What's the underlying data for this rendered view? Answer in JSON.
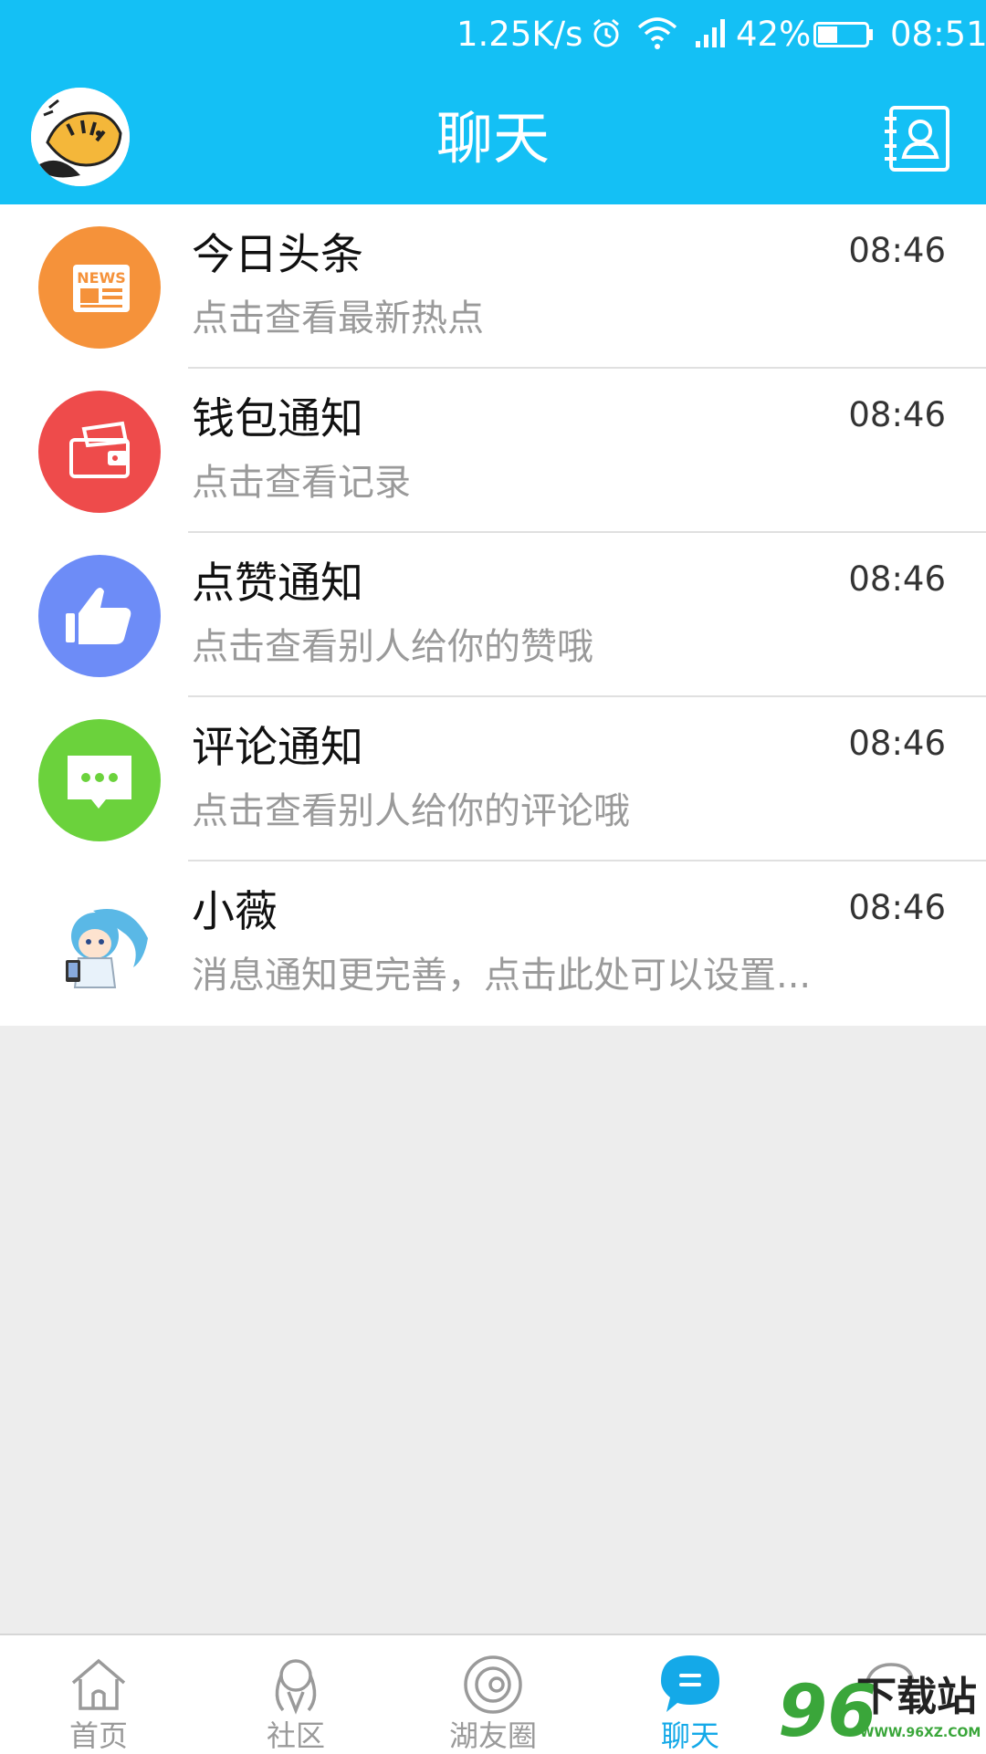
{
  "status_bar": {
    "net_speed": "1.25K/s",
    "battery_percent": "42%",
    "battery_level": 0.42,
    "clock": "08:51"
  },
  "header": {
    "title": "聊天"
  },
  "chats": [
    {
      "title": "今日头条",
      "subtitle": "点击查看最新热点",
      "time": "08:46",
      "icon": "news-icon",
      "color": "#f5923a"
    },
    {
      "title": "钱包通知",
      "subtitle": "点击查看记录",
      "time": "08:46",
      "icon": "wallet-icon",
      "color": "#ee4b4b"
    },
    {
      "title": "点赞通知",
      "subtitle": "点击查看别人给你的赞哦",
      "time": "08:46",
      "icon": "thumbs-up-icon",
      "color": "#6d8cf7"
    },
    {
      "title": "评论通知",
      "subtitle": "点击查看别人给你的评论哦",
      "time": "08:46",
      "icon": "comment-icon",
      "color": "#6bd23c"
    },
    {
      "title": "小薇",
      "subtitle": "消息通知更完善，点击此处可以设置...",
      "time": "08:46",
      "icon": "assistant-avatar-icon",
      "color": "#5ab8e6"
    }
  ],
  "bottom_nav": [
    {
      "label": "首页",
      "icon": "home-icon",
      "active": false
    },
    {
      "label": "社区",
      "icon": "community-icon",
      "active": false
    },
    {
      "label": "湖友圈",
      "icon": "friends-circle-icon",
      "active": false
    },
    {
      "label": "聊天",
      "icon": "chat-icon",
      "active": true
    },
    {
      "label": "",
      "icon": "more-icon",
      "active": false
    }
  ],
  "colors": {
    "brand": "#14c0f5",
    "active_tab": "#14a9e8",
    "background": "#ededed"
  },
  "watermark": {
    "number": "96",
    "text": "下载站",
    "url": "WWW.96XZ.COM"
  }
}
